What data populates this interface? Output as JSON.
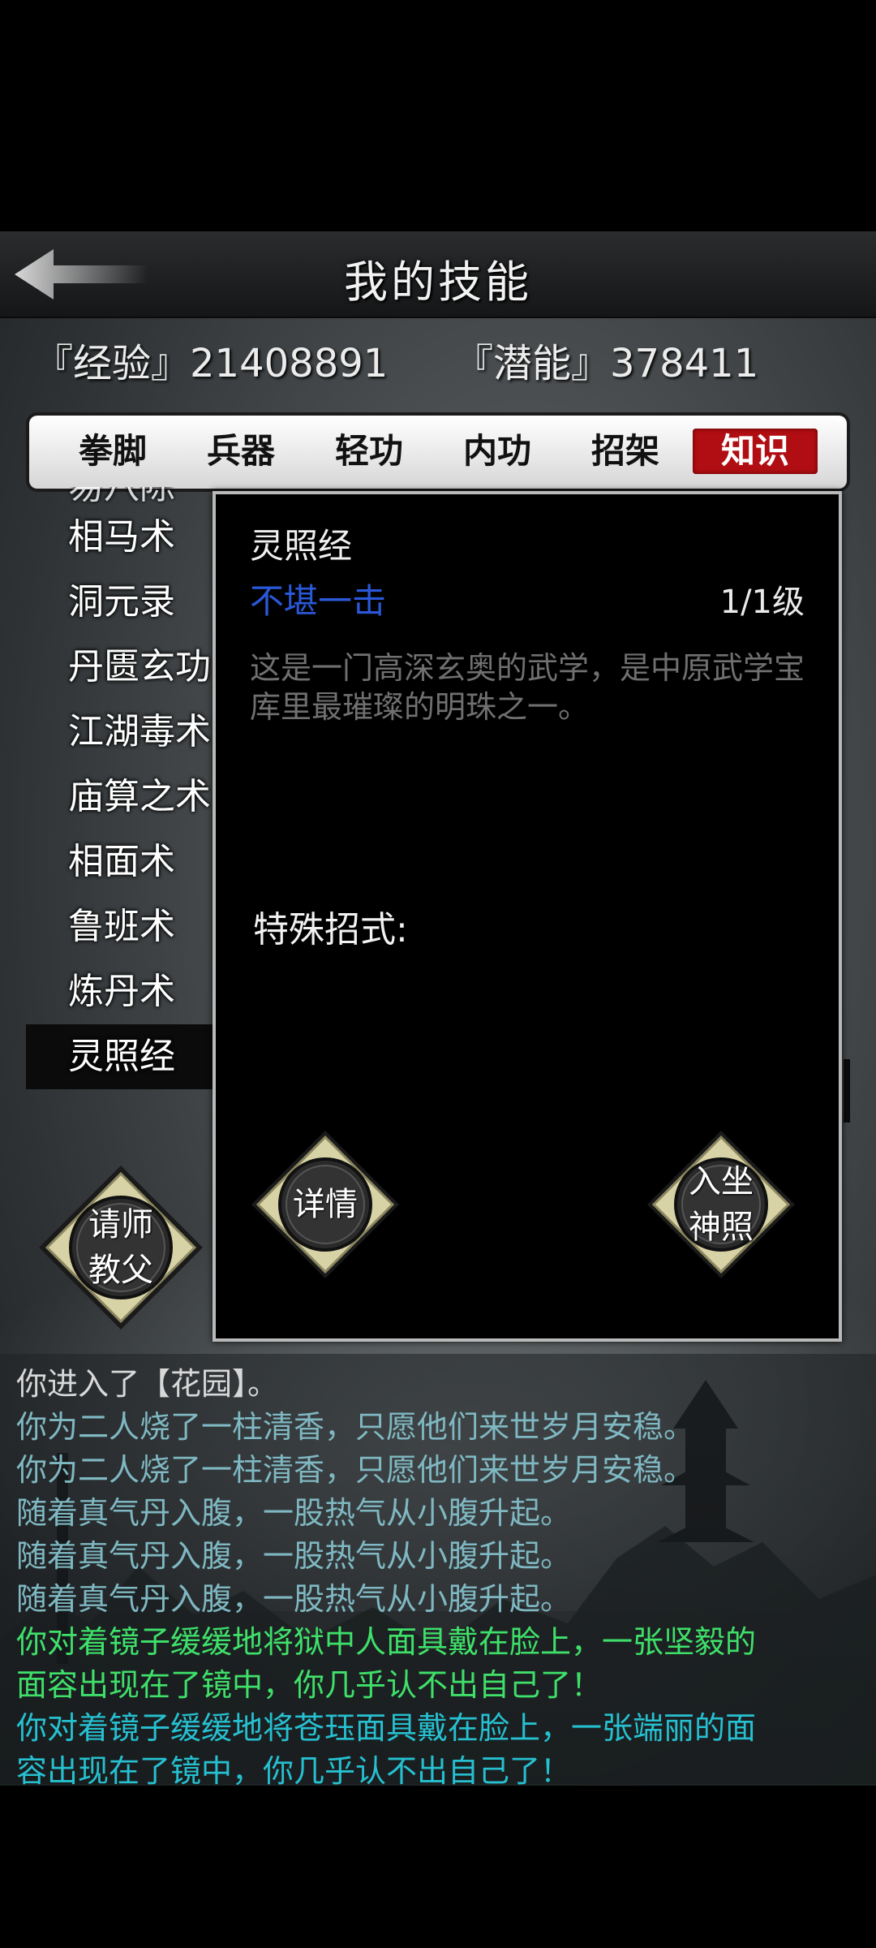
{
  "header": {
    "title": "我的技能",
    "back_icon": "back-arrow-icon"
  },
  "stats": {
    "exp_label": "『经验』21408891",
    "potential_label": "『潜能』378411"
  },
  "tabs": [
    {
      "label": "拳脚",
      "active": false
    },
    {
      "label": "兵器",
      "active": false
    },
    {
      "label": "轻功",
      "active": false
    },
    {
      "label": "内功",
      "active": false
    },
    {
      "label": "招架",
      "active": false
    },
    {
      "label": "知识",
      "active": true
    }
  ],
  "skill_list": [
    {
      "label": "易八陈"
    },
    {
      "label": "相马术"
    },
    {
      "label": "洞元录"
    },
    {
      "label": "丹匮玄功"
    },
    {
      "label": "江湖毒术"
    },
    {
      "label": "庙算之术"
    },
    {
      "label": "相面术"
    },
    {
      "label": "鲁班术"
    },
    {
      "label": "炼丹术"
    },
    {
      "label": "灵照经",
      "selected": true
    }
  ],
  "buttons": {
    "ask_master_line1": "请师",
    "ask_master_line2": "教父",
    "details": "详情",
    "meditate_line1": "入坐",
    "meditate_line2": "神照"
  },
  "popup": {
    "name": "灵照经",
    "rank": "不堪一击",
    "level": "1/1级",
    "description": "这是一门高深玄奥的武学，是中原武学宝库里最璀璨的明珠之一。",
    "special_label": "特殊招式:"
  },
  "log": [
    {
      "text": "你进入了【花园】。",
      "color": "#d8d8d8"
    },
    {
      "text": "你为二人烧了一柱清香，只愿他们来世岁月安稳。",
      "color": "#7fb8c2"
    },
    {
      "text": "你为二人烧了一柱清香，只愿他们来世岁月安稳。",
      "color": "#7fb8c2"
    },
    {
      "text": "随着真气丹入腹，一股热气从小腹升起。",
      "color": "#7fb8c2"
    },
    {
      "text": "随着真气丹入腹，一股热气从小腹升起。",
      "color": "#7fb8c2"
    },
    {
      "text": "随着真气丹入腹，一股热气从小腹升起。",
      "color": "#7fb8c2"
    },
    {
      "text": "你对着镜子缓缓地将狱中人面具戴在脸上，一张坚毅的",
      "color": "#3fe06a"
    },
    {
      "text": "面容出现在了镜中，你几乎认不出自己了！",
      "color": "#3fe06a"
    },
    {
      "text": "你对着镜子缓缓地将苍珏面具戴在脸上，一张端丽的面",
      "color": "#26c0d0"
    },
    {
      "text": "容出现在了镜中，你几乎认不出自己了！",
      "color": "#26c0d0"
    }
  ],
  "colors": {
    "active_tab": "#b00e12",
    "rank_text": "#2a58d8",
    "popup_border": "#b9b9b9"
  }
}
